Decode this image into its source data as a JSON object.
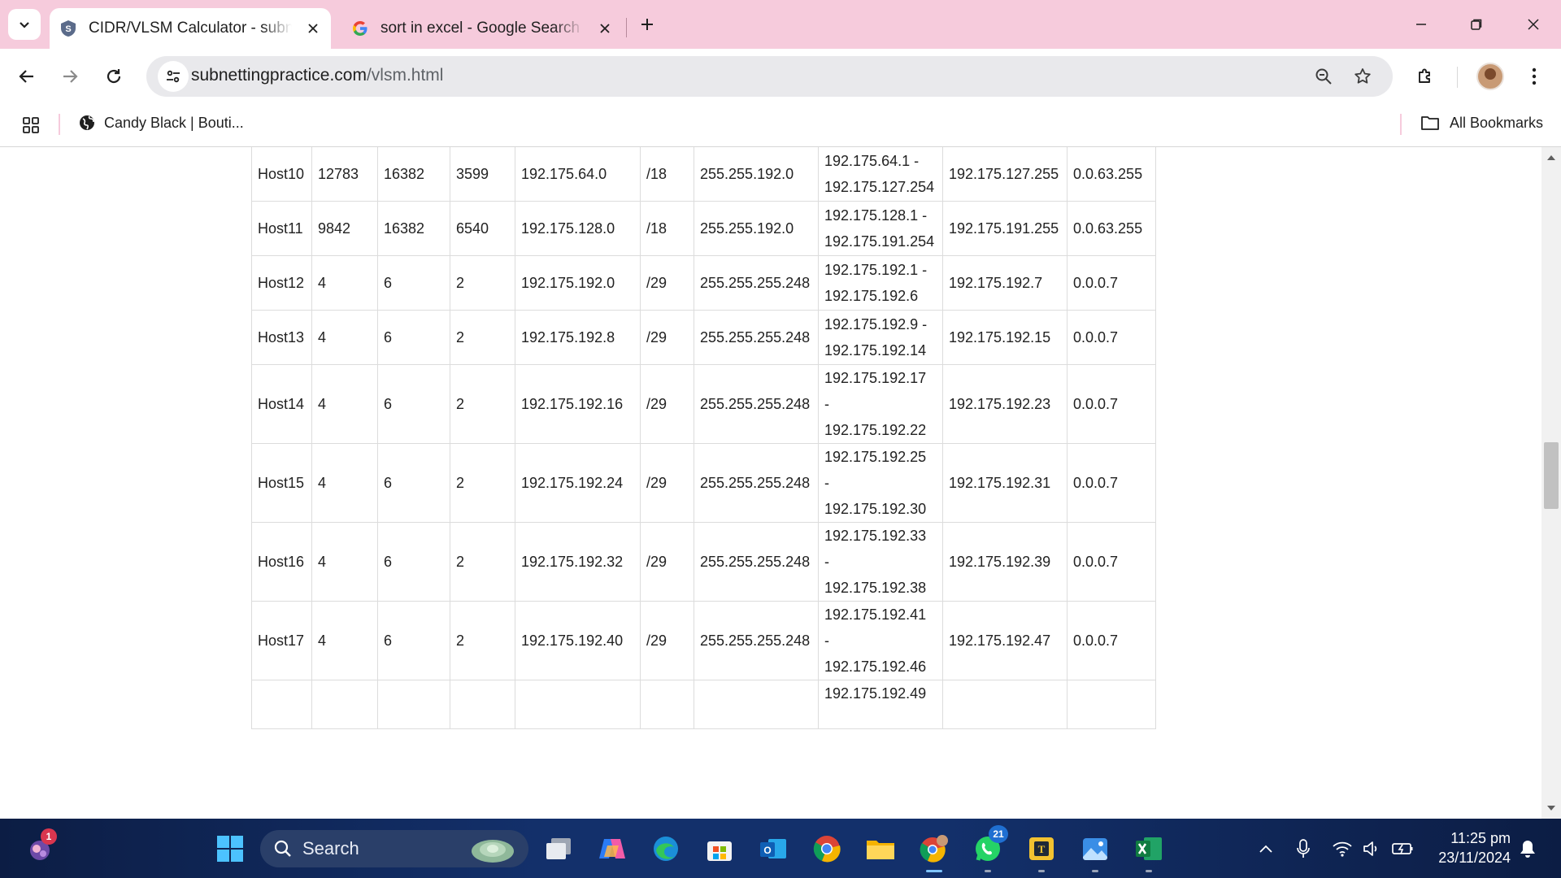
{
  "browser": {
    "tabs": [
      {
        "title": "CIDR/VLSM Calculator - subnetti",
        "active": true
      },
      {
        "title": "sort in excel - Google Search",
        "active": false
      }
    ],
    "url_domain": "subnettingpractice.com",
    "url_path": "/vlsm.html",
    "bookmarks": [
      {
        "label": "Candy Black | Bouti..."
      }
    ],
    "all_bookmarks_label": "All Bookmarks"
  },
  "table": {
    "rows": [
      {
        "name": "Host10",
        "needed": "12783",
        "allocated": "16382",
        "unused": "3599",
        "network": "192.175.64.0",
        "cidr": "/18",
        "mask": "255.255.192.0",
        "range": [
          "192.175.64.1 -",
          "192.175.127.254"
        ],
        "broadcast": "192.175.127.255",
        "wildcard": "0.0.63.255"
      },
      {
        "name": "Host11",
        "needed": "9842",
        "allocated": "16382",
        "unused": "6540",
        "network": "192.175.128.0",
        "cidr": "/18",
        "mask": "255.255.192.0",
        "range": [
          "192.175.128.1 -",
          "192.175.191.254"
        ],
        "broadcast": "192.175.191.255",
        "wildcard": "0.0.63.255"
      },
      {
        "name": "Host12",
        "needed": "4",
        "allocated": "6",
        "unused": "2",
        "network": "192.175.192.0",
        "cidr": "/29",
        "mask": "255.255.255.248",
        "range": [
          "192.175.192.1 -",
          "192.175.192.6"
        ],
        "broadcast": "192.175.192.7",
        "wildcard": "0.0.0.7"
      },
      {
        "name": "Host13",
        "needed": "4",
        "allocated": "6",
        "unused": "2",
        "network": "192.175.192.8",
        "cidr": "/29",
        "mask": "255.255.255.248",
        "range": [
          "192.175.192.9 -",
          "192.175.192.14"
        ],
        "broadcast": "192.175.192.15",
        "wildcard": "0.0.0.7"
      },
      {
        "name": "Host14",
        "needed": "4",
        "allocated": "6",
        "unused": "2",
        "network": "192.175.192.16",
        "cidr": "/29",
        "mask": "255.255.255.248",
        "range": [
          "192.175.192.17",
          "-",
          "192.175.192.22"
        ],
        "broadcast": "192.175.192.23",
        "wildcard": "0.0.0.7"
      },
      {
        "name": "Host15",
        "needed": "4",
        "allocated": "6",
        "unused": "2",
        "network": "192.175.192.24",
        "cidr": "/29",
        "mask": "255.255.255.248",
        "range": [
          "192.175.192.25",
          "-",
          "192.175.192.30"
        ],
        "broadcast": "192.175.192.31",
        "wildcard": "0.0.0.7"
      },
      {
        "name": "Host16",
        "needed": "4",
        "allocated": "6",
        "unused": "2",
        "network": "192.175.192.32",
        "cidr": "/29",
        "mask": "255.255.255.248",
        "range": [
          "192.175.192.33",
          "-",
          "192.175.192.38"
        ],
        "broadcast": "192.175.192.39",
        "wildcard": "0.0.0.7"
      },
      {
        "name": "Host17",
        "needed": "4",
        "allocated": "6",
        "unused": "2",
        "network": "192.175.192.40",
        "cidr": "/29",
        "mask": "255.255.255.248",
        "range": [
          "192.175.192.41",
          "-",
          "192.175.192.46"
        ],
        "broadcast": "192.175.192.47",
        "wildcard": "0.0.0.7"
      },
      {
        "name": "",
        "needed": "",
        "allocated": "",
        "unused": "",
        "network": "",
        "cidr": "",
        "mask": "",
        "range": [
          "192.175.192.49"
        ],
        "broadcast": "",
        "wildcard": ""
      }
    ]
  },
  "taskbar": {
    "search_placeholder": "Search",
    "pinned": [
      {
        "icon": "task-view-icon"
      },
      {
        "icon": "copilot-icon"
      },
      {
        "icon": "edge-icon"
      },
      {
        "icon": "store-icon"
      },
      {
        "icon": "outlook-icon"
      },
      {
        "icon": "chrome-icon"
      },
      {
        "icon": "file-explorer-icon"
      },
      {
        "icon": "chrome-profile-icon"
      },
      {
        "icon": "whatsapp-icon"
      },
      {
        "icon": "app-icon"
      },
      {
        "icon": "photos-icon"
      },
      {
        "icon": "excel-icon"
      }
    ],
    "widgets_badge": "1",
    "whatsapp_badge": "21",
    "clock_time": "11:25 pm",
    "clock_date": "23/11/2024"
  },
  "colors": {
    "tabstrip": "#f6cbdc",
    "omnibox": "#e9e9ec",
    "taskbar": "#13306b",
    "accent": "#1a73e8"
  }
}
